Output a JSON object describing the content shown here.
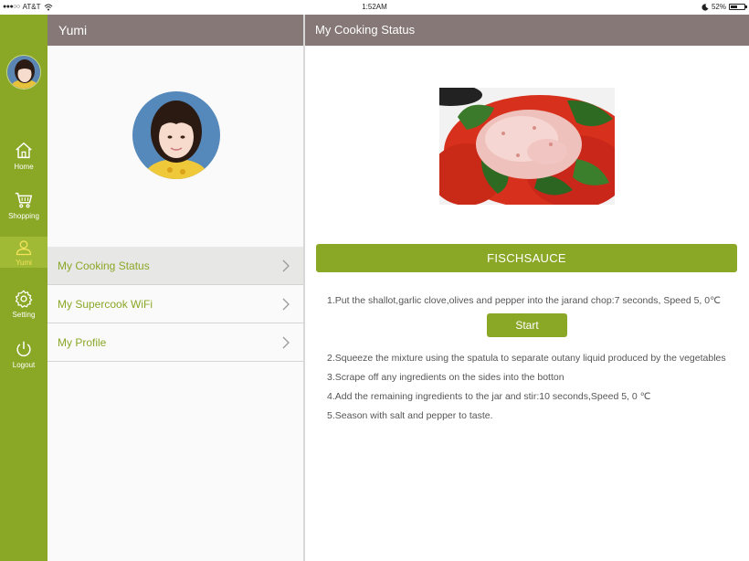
{
  "status_bar": {
    "signal_dots": "●●●○○",
    "carrier": "AT&T",
    "time": "1:52AM",
    "battery_text": "52%",
    "battery_level": 0.52
  },
  "colors": {
    "brand_green": "#8aa726",
    "header_taupe": "#857876",
    "active_rail": "#a1ba35",
    "active_rail_text": "#f2e35a"
  },
  "nav": {
    "items": [
      {
        "label": "Home",
        "icon": "home-icon"
      },
      {
        "label": "Shopping",
        "icon": "shopping-cart-icon"
      },
      {
        "label": "Yumi",
        "icon": "user-icon",
        "active": true
      },
      {
        "label": "Setting",
        "icon": "gear-icon"
      },
      {
        "label": "Logout",
        "icon": "power-icon"
      }
    ]
  },
  "profile": {
    "title": "Yumi",
    "menu": [
      {
        "label": "My Cooking Status",
        "active": true
      },
      {
        "label": "My Supercook WiFi"
      },
      {
        "label": "My Profile"
      }
    ]
  },
  "cooking": {
    "title": "My Cooking Status",
    "recipe_name": "FISCHSAUCE",
    "start_label": "Start",
    "steps": [
      "1.Put the shallot,garlic clove,olives and pepper into the jarand chop:7 seconds, Speed 5, 0℃",
      "2.Squeeze the  mixture using the spatula to separate outany liquid produced by the vegetables",
      "3.Scrape off any ingredients on the sides into the botton",
      "4.Add the remaining ingredients to the jar and stir:10 seconds,Speed 5, 0 ℃",
      "5.Season with salt and pepper to taste."
    ]
  }
}
